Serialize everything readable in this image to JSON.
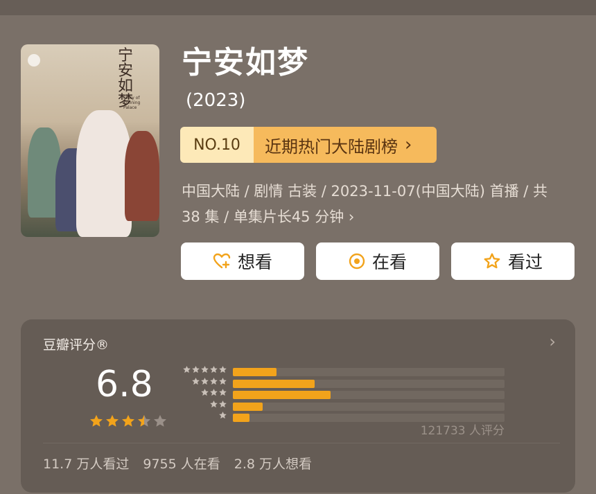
{
  "poster": {
    "title_art": "宁安如梦",
    "subtitle_art": "Story of Kunning Palace"
  },
  "header": {
    "title": "宁安如梦",
    "year": "(2023)"
  },
  "ranking": {
    "number": "NO.10",
    "list_name": "近期热门大陆剧榜",
    "chevron": "›"
  },
  "info": {
    "line1": "中国大陆 / 剧情 古装 / 2023-11-07(中国大陆) 首播 / 共",
    "line2": "38 集 / 单集片长45 分钟",
    "more": "›"
  },
  "actions": {
    "want": "想看",
    "watching": "在看",
    "watched": "看过"
  },
  "rating": {
    "label": "豆瓣评分®",
    "chevron": "›",
    "score": "6.8",
    "stars_value": 3.5,
    "stars_max": 5,
    "distribution": [
      {
        "stars": 5,
        "fraction": 0.16
      },
      {
        "stars": 4,
        "fraction": 0.3
      },
      {
        "stars": 3,
        "fraction": 0.36
      },
      {
        "stars": 2,
        "fraction": 0.11
      },
      {
        "stars": 1,
        "fraction": 0.06
      }
    ],
    "count_text": "121733 人评分",
    "accent_color": "#f2a31b"
  },
  "stats": {
    "watched": "11.7 万人看过",
    "watching": "9755 人在看",
    "want": "2.8 万人想看"
  }
}
